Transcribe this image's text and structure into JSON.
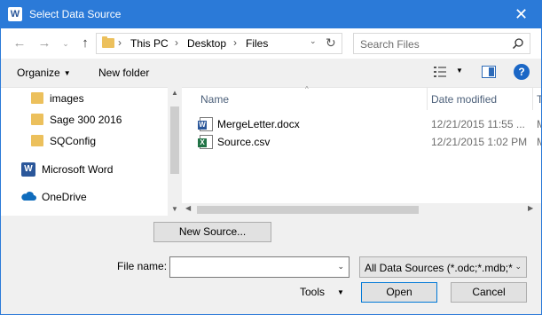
{
  "window": {
    "title": "Select Data Source",
    "app_icon": "W",
    "close_glyph": "✕"
  },
  "nav": {
    "back_glyph": "←",
    "forward_glyph": "→",
    "recent_glyph": "⌄",
    "up_glyph": "↑",
    "breadcrumbs": [
      "This PC",
      "Desktop",
      "Files"
    ],
    "separator": "›",
    "dropdown_glyph": "⌄",
    "refresh_glyph": "↻"
  },
  "search": {
    "placeholder": "Search Files"
  },
  "toolbar": {
    "organize_label": "Organize",
    "caret": "▼",
    "new_folder_label": "New folder",
    "help_label": "?"
  },
  "sidebar": {
    "items": [
      {
        "label": "images",
        "icon": "folder-icon"
      },
      {
        "label": "Sage 300 2016",
        "icon": "folder-icon"
      },
      {
        "label": "SQConfig",
        "icon": "folder-icon"
      },
      {
        "label": "Microsoft Word",
        "icon": "word-icon"
      },
      {
        "label": "OneDrive",
        "icon": "onedrive-icon"
      }
    ]
  },
  "file_list": {
    "columns": {
      "name": "Name",
      "date": "Date modified",
      "type_partial": "T"
    },
    "sort_glyph": "^",
    "rows": [
      {
        "name": "MergeLetter.docx",
        "date": "12/21/2015 11:55 ...",
        "type_partial": "M",
        "icon": "word-doc-icon",
        "icon_letter": "W",
        "icon_color": "#2b579a"
      },
      {
        "name": "Source.csv",
        "date": "12/21/2015 1:02 PM",
        "type_partial": "M",
        "icon": "excel-csv-icon",
        "icon_letter": "X",
        "icon_color": "#217346"
      }
    ]
  },
  "scroll": {
    "up_glyph": "▲",
    "down_glyph": "▼",
    "left_glyph": "◀",
    "right_glyph": "▶"
  },
  "bottom": {
    "new_source_label": "New Source...",
    "file_name_label": "File name:",
    "file_name_value": "",
    "filter_value": "All Data Sources (*.odc;*.mdb;*",
    "tools_label": "Tools",
    "open_label": "Open",
    "cancel_label": "Cancel"
  },
  "colors": {
    "titlebar": "#2b7ad8",
    "folder": "#ecc05c",
    "accent": "#0078d7"
  }
}
